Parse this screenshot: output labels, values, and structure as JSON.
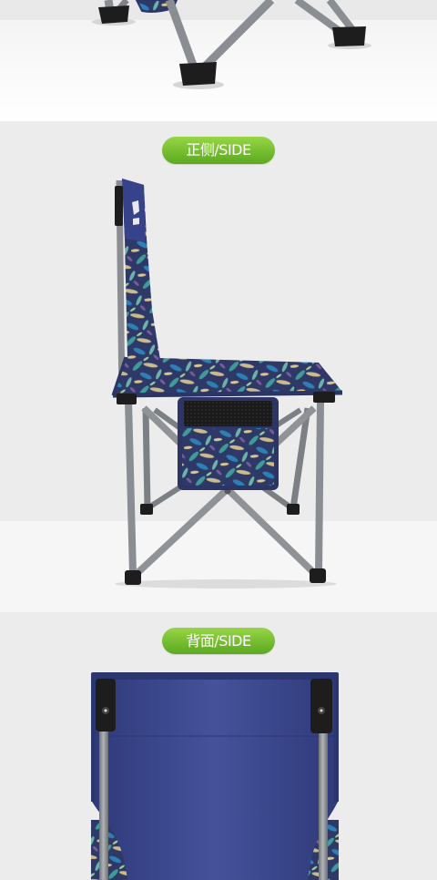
{
  "side_view": {
    "label": "正侧/SIDE"
  },
  "back_view": {
    "label": "背面/SIDE"
  },
  "colors": {
    "pill_top": "#97d646",
    "pill_bottom": "#5ba81f",
    "fabric_navy": "#36428a",
    "frame_gray": "#8a8e92",
    "foot_cap": "#1d1d1d",
    "backdrop": "#ececec",
    "floor": "#f6f6f6"
  }
}
